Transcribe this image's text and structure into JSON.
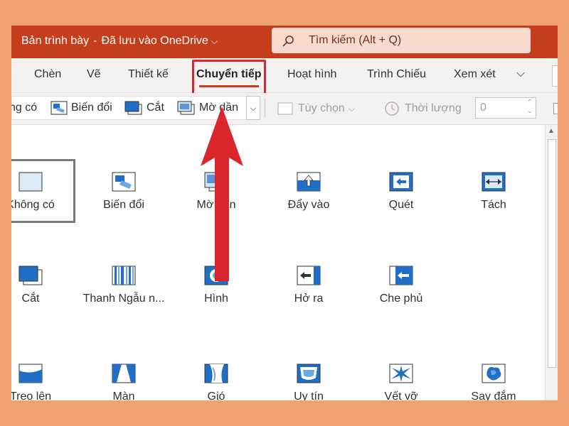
{
  "titlebar": {
    "doc_name": "Bản trình bày",
    "separator": "-",
    "save_status": "Đã lưu vào OneDrive",
    "search_placeholder": "Tìm kiếm (Alt + Q)"
  },
  "tabs": [
    {
      "label": "Chèn"
    },
    {
      "label": "Vẽ"
    },
    {
      "label": "Thiết kế"
    },
    {
      "label": "Chuyển tiếp",
      "active": true
    },
    {
      "label": "Hoạt hình"
    },
    {
      "label": "Trình Chiếu"
    },
    {
      "label": "Xem xét"
    }
  ],
  "toolbar": {
    "gallery": [
      {
        "label": "ng có"
      },
      {
        "label": "Biến đổi"
      },
      {
        "label": "Cắt"
      },
      {
        "label": "Mờ dần"
      }
    ],
    "effect_options": "Tùy chọn",
    "duration_label": "Thời lượng",
    "duration_value": "0"
  },
  "transitions": [
    {
      "label": "Không có"
    },
    {
      "label": "Biến đổi"
    },
    {
      "label": "Mờ dần"
    },
    {
      "label": "Đẩy vào"
    },
    {
      "label": "Quét"
    },
    {
      "label": "Tách"
    },
    {
      "label": "Cắt"
    },
    {
      "label": "Thanh Ngẫu n..."
    },
    {
      "label": "Hình"
    },
    {
      "label": "Hở ra"
    },
    {
      "label": "Che phủ"
    },
    {
      "label": "Treo lên"
    },
    {
      "label": "Màn"
    },
    {
      "label": "Gió"
    },
    {
      "label": "Uy tín"
    },
    {
      "label": "Vết vỡ"
    },
    {
      "label": "Say đắm"
    }
  ],
  "colors": {
    "accent": "#C43E1C",
    "background": "#EFA271",
    "annotation": "#D8262C"
  }
}
